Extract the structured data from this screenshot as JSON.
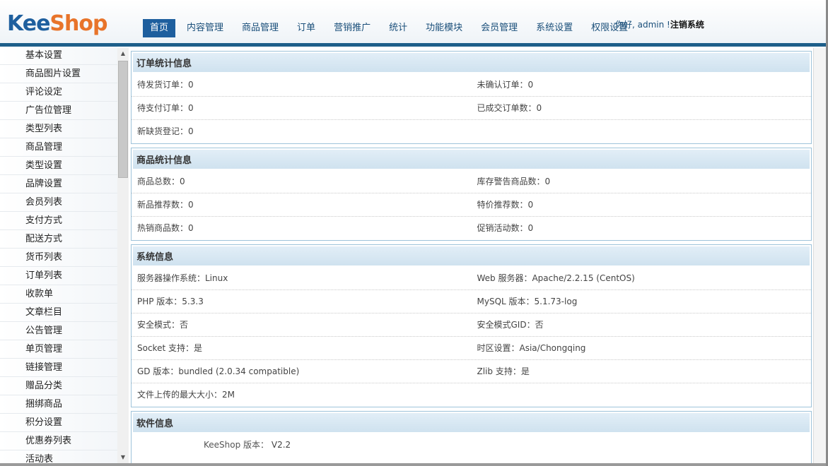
{
  "logo": {
    "part1": "Kee",
    "part2": "Shop"
  },
  "nav": [
    {
      "label": "首页",
      "active": true
    },
    {
      "label": "内容管理"
    },
    {
      "label": "商品管理"
    },
    {
      "label": "订单"
    },
    {
      "label": "营销推广"
    },
    {
      "label": "统计"
    },
    {
      "label": "功能模块"
    },
    {
      "label": "会员管理"
    },
    {
      "label": "系统设置"
    },
    {
      "label": "权限设置"
    }
  ],
  "user": {
    "greeting": "你好, admin !",
    "logout": "注销系统"
  },
  "sidebar": {
    "items": [
      "基本设置",
      "商品图片设置",
      "评论设定",
      "广告位管理",
      "类型列表",
      "商品管理",
      "类型设置",
      "品牌设置",
      "会员列表",
      "支付方式",
      "配送方式",
      "货币列表",
      "订单列表",
      "收款单",
      "文章栏目",
      "公告管理",
      "单页管理",
      "链接管理",
      "赠品分类",
      "捆绑商品",
      "积分设置",
      "优惠券列表",
      "活动表"
    ]
  },
  "panels": {
    "orders": {
      "title": "订单统计信息",
      "rows": [
        [
          "待发货订单：0",
          "未确认订单：0"
        ],
        [
          "待支付订单：0",
          "已成交订单数：0"
        ],
        [
          "新缺货登记：0",
          ""
        ]
      ]
    },
    "goods": {
      "title": "商品统计信息",
      "rows": [
        [
          "商品总数：0",
          "库存警告商品数：0"
        ],
        [
          "新品推荐数：0",
          "特价推荐数：0"
        ],
        [
          "热销商品数：0",
          "促销活动数：0"
        ]
      ]
    },
    "system": {
      "title": "系统信息",
      "rows": [
        [
          "服务器操作系统：Linux",
          "Web 服务器：Apache/2.2.15 (CentOS)"
        ],
        [
          "PHP 版本：5.3.3",
          "MySQL 版本：5.1.73-log"
        ],
        [
          "安全模式：否",
          "安全模式GID：否"
        ],
        [
          "Socket 支持：是",
          "时区设置：Asia/Chongqing"
        ],
        [
          "GD 版本：bundled (2.0.34 compatible)",
          "Zlib 支持：是"
        ],
        [
          "文件上传的最大大小：2M",
          ""
        ]
      ]
    },
    "software": {
      "title": "软件信息",
      "version_label": "KeeShop 版本：",
      "version_value": "V2.2"
    }
  },
  "icons": {
    "scroll_up": "triangle-up",
    "scroll_down": "triangle-down"
  }
}
